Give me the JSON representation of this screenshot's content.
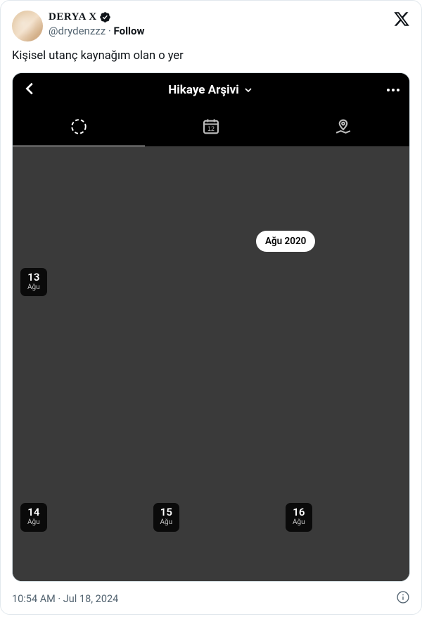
{
  "tweet": {
    "display_name": "DERYA X",
    "handle": "@drydenzzz",
    "follow_label": "Follow",
    "text": "Kişisel utanç kaynağım olan o yer",
    "timestamp": "10:54 AM · Jul 18, 2024"
  },
  "archive": {
    "title": "Hikaye Arşivi",
    "month_pill": "Ağu 2020",
    "calendar_day": "12",
    "dates": {
      "row2_col1": {
        "day": "13",
        "month": "Ağu"
      },
      "row3_col1": {
        "day": "14",
        "month": "Ağu"
      },
      "row3_col2": {
        "day": "15",
        "month": "Ağu"
      },
      "row3_col3": {
        "day": "16",
        "month": "Ağu"
      }
    }
  }
}
